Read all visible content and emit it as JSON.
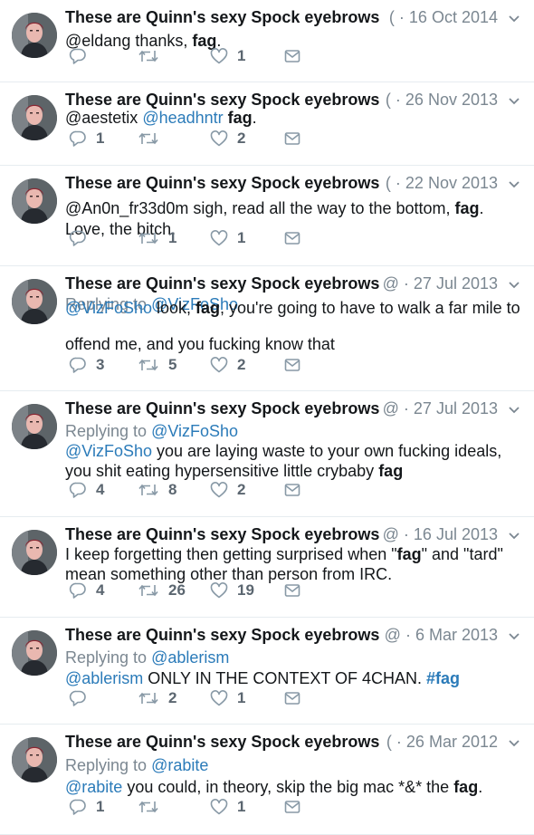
{
  "colors": {
    "name": "#14171a",
    "meta": "#7b8791",
    "link": "#2b7bb9",
    "divider": "#e6ecf0",
    "icon": "#8899a6"
  },
  "tweets": [
    {
      "name": "These are Quinn's sexy Spock eyebrows",
      "handle": "(",
      "date": "16 Oct 2014",
      "replying_to": null,
      "body": [
        [
          {
            "t": "@eldang thanks, ",
            "s": "text"
          },
          {
            "t": "fag",
            "s": "bold"
          },
          {
            "t": ".",
            "s": "text"
          }
        ]
      ],
      "counts": {
        "reply": "",
        "retweet": "",
        "like": "1"
      }
    },
    {
      "name": "These are Quinn's sexy Spock eyebrows",
      "handle": "(",
      "date": "26 Nov 2013",
      "replying_to": null,
      "body": [
        [
          {
            "t": "@aestetix ",
            "s": "text"
          },
          {
            "t": "@headhntr",
            "s": "link"
          },
          {
            "t": " ",
            "s": "text"
          },
          {
            "t": "fag",
            "s": "bold"
          },
          {
            "t": ".",
            "s": "text"
          }
        ]
      ],
      "counts": {
        "reply": "1",
        "retweet": "",
        "like": "2"
      }
    },
    {
      "name": "These are Quinn's sexy Spock eyebrows",
      "handle": "(",
      "date": "22 Nov 2013",
      "replying_to": null,
      "body": [
        [
          {
            "t": "@An0n_fr33d0m sigh, read all the way to the bottom, ",
            "s": "text"
          },
          {
            "t": "fag",
            "s": "bold"
          },
          {
            "t": ".",
            "s": "text"
          }
        ],
        [
          {
            "t": "Love, the bitch.",
            "s": "text"
          }
        ]
      ],
      "counts": {
        "reply": "",
        "retweet": "1",
        "like": "1"
      }
    },
    {
      "name": "These are Quinn's sexy Spock eyebrows",
      "handle": "@",
      "date": "27 Jul 2013",
      "replying_to": "Replying to @VizFoSho",
      "body": [
        [
          {
            "t": "@VizFoSho",
            "s": "link"
          },
          {
            "t": " look, ",
            "s": "text"
          },
          {
            "t": "fag",
            "s": "bold"
          },
          {
            "t": ", you're going to have to walk a far mile to",
            "s": "text"
          }
        ],
        [
          {
            "t": "offend me, and you fucking know that",
            "s": "text"
          }
        ]
      ],
      "counts": {
        "reply": "3",
        "retweet": "5",
        "like": "2"
      }
    },
    {
      "name": "These are Quinn's sexy Spock eyebrows",
      "handle": "@",
      "date": "27 Jul 2013",
      "replying_to": "Replying to @VizFoSho",
      "body": [
        [
          {
            "t": "@VizFoSho",
            "s": "link"
          },
          {
            "t": " you are laying waste to your own fucking ideals,",
            "s": "text"
          }
        ],
        [
          {
            "t": "you shit eating hypersensitive little crybaby ",
            "s": "text"
          },
          {
            "t": "fag",
            "s": "bold"
          }
        ]
      ],
      "counts": {
        "reply": "4",
        "retweet": "8",
        "like": "2"
      }
    },
    {
      "name": "These are Quinn's sexy Spock eyebrows",
      "handle": "@",
      "date": "16 Jul 2013",
      "replying_to": null,
      "body": [
        [
          {
            "t": "I keep forgetting then getting surprised when \"",
            "s": "text"
          },
          {
            "t": "fag",
            "s": "bold"
          },
          {
            "t": "\" and \"tard\"",
            "s": "text"
          }
        ],
        [
          {
            "t": "mean something other than person from IRC.",
            "s": "text"
          }
        ]
      ],
      "counts": {
        "reply": "4",
        "retweet": "26",
        "like": "19"
      }
    },
    {
      "name": "These are Quinn's sexy Spock eyebrows",
      "handle": "@",
      "date": "6 Mar 2013",
      "replying_to": "Replying to @ablerism",
      "body": [
        [
          {
            "t": "@ablerism",
            "s": "link"
          },
          {
            "t": " ONLY IN THE CONTEXT OF 4CHAN. ",
            "s": "text"
          },
          {
            "t": "#fag",
            "s": "link-bold"
          }
        ]
      ],
      "counts": {
        "reply": "",
        "retweet": "2",
        "like": "1"
      }
    },
    {
      "name": "These are Quinn's sexy Spock eyebrows",
      "handle": "(",
      "date": "26 Mar 2012",
      "replying_to": "Replying to @rabite",
      "body": [
        [
          {
            "t": "@rabite",
            "s": "link"
          },
          {
            "t": " you could, in theory, skip the big mac *&* the ",
            "s": "text"
          },
          {
            "t": "fag",
            "s": "bold"
          },
          {
            "t": ".",
            "s": "text"
          }
        ]
      ],
      "counts": {
        "reply": "1",
        "retweet": "",
        "like": "1"
      }
    }
  ]
}
